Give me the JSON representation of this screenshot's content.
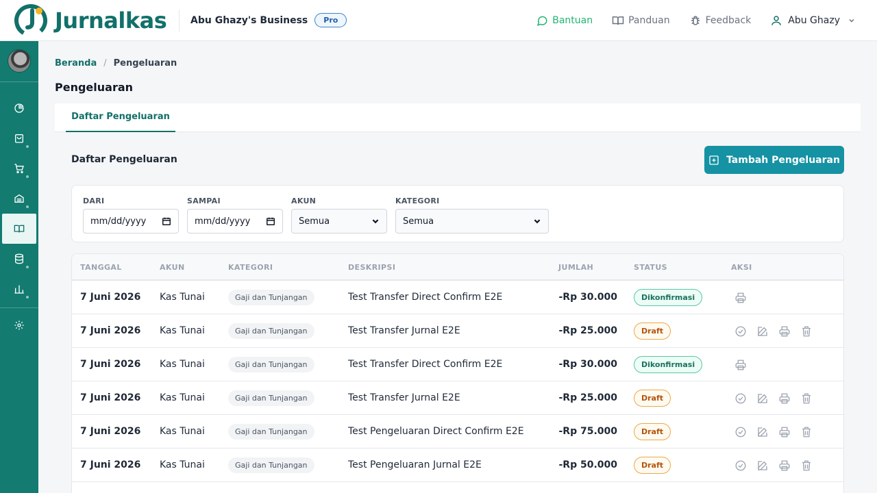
{
  "header": {
    "brand": "Jurnalkas",
    "business_name": "Abu Ghazy's Business",
    "plan_badge": "Pro",
    "links": {
      "help": "Bantuan",
      "guide": "Panduan",
      "feedback": "Feedback"
    },
    "user_name": "Abu Ghazy"
  },
  "breadcrumb": {
    "home": "Beranda",
    "separator": "/",
    "current": "Pengeluaran"
  },
  "page": {
    "title": "Pengeluaran",
    "tab": "Daftar Pengeluaran",
    "section_title": "Daftar Pengeluaran",
    "add_button": "Tambah Pengeluaran"
  },
  "filters": {
    "from_label": "DARI",
    "from_value": "mm/dd/yyyy",
    "to_label": "SAMPAI",
    "to_value": "mm/dd/yyyy",
    "account_label": "AKUN",
    "account_value": "Semua",
    "category_label": "KATEGORI",
    "category_value": "Semua"
  },
  "table": {
    "columns": {
      "date": "TANGGAL",
      "account": "AKUN",
      "category": "KATEGORI",
      "description": "DESKRIPSI",
      "amount": "JUMLAH",
      "status": "STATUS",
      "action": "AKSI"
    },
    "rows": [
      {
        "date": "7 Juni 2026",
        "account": "Kas Tunai",
        "category": "Gaji dan Tunjangan",
        "description": "Test Transfer Direct Confirm E2E",
        "amount": "-Rp 30.000",
        "status": "Dikonfirmasi"
      },
      {
        "date": "7 Juni 2026",
        "account": "Kas Tunai",
        "category": "Gaji dan Tunjangan",
        "description": "Test Transfer Jurnal E2E",
        "amount": "-Rp 25.000",
        "status": "Draft"
      },
      {
        "date": "7 Juni 2026",
        "account": "Kas Tunai",
        "category": "Gaji dan Tunjangan",
        "description": "Test Transfer Direct Confirm E2E",
        "amount": "-Rp 30.000",
        "status": "Dikonfirmasi"
      },
      {
        "date": "7 Juni 2026",
        "account": "Kas Tunai",
        "category": "Gaji dan Tunjangan",
        "description": "Test Transfer Jurnal E2E",
        "amount": "-Rp 25.000",
        "status": "Draft"
      },
      {
        "date": "7 Juni 2026",
        "account": "Kas Tunai",
        "category": "Gaji dan Tunjangan",
        "description": "Test Pengeluaran Direct Confirm E2E",
        "amount": "-Rp 75.000",
        "status": "Draft"
      },
      {
        "date": "7 Juni 2026",
        "account": "Kas Tunai",
        "category": "Gaji dan Tunjangan",
        "description": "Test Pengeluaran Jurnal E2E",
        "amount": "-Rp 50.000",
        "status": "Draft"
      }
    ]
  },
  "colors": {
    "brand": "#137b70",
    "accent_button": "#1592a3",
    "help_link": "#22b573"
  },
  "icons": {
    "sidebar": [
      "chart-pie-icon",
      "shopping-bag-icon",
      "cart-icon",
      "inventory-icon",
      "book-icon",
      "database-icon",
      "bar-chart-icon",
      "gear-icon"
    ],
    "row_actions_confirmed": [
      "print-icon"
    ],
    "row_actions_draft": [
      "confirm-icon",
      "edit-icon",
      "print-icon",
      "trash-icon"
    ]
  }
}
